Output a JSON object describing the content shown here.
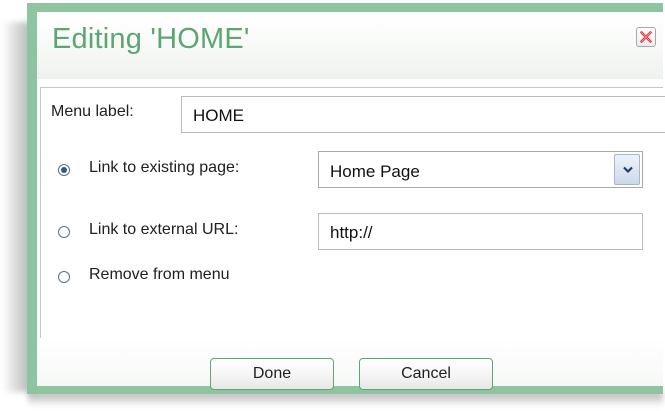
{
  "dialog": {
    "title": "Editing 'HOME'",
    "close_icon": "close-icon",
    "accent_color": "#8ec49f",
    "title_color": "#5ea574"
  },
  "form": {
    "menu_label": {
      "label": "Menu label:",
      "value": "HOME"
    },
    "options": [
      {
        "label": "Link to existing page:",
        "selected": true
      },
      {
        "label": "Link to external URL:",
        "selected": false
      },
      {
        "label": "Remove from menu",
        "selected": false
      }
    ],
    "existing_page_select": {
      "value": "Home Page",
      "icon": "chevron-down-icon"
    },
    "external_url": {
      "value": "http://"
    }
  },
  "footer": {
    "done_label": "Done",
    "cancel_label": "Cancel"
  }
}
